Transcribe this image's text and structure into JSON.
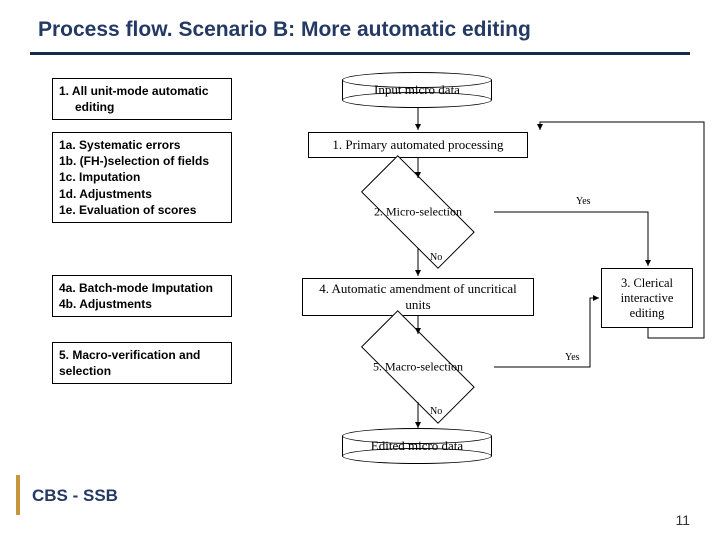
{
  "title": "Process flow. Scenario B: More automatic editing",
  "footer": {
    "label": "CBS - SSB",
    "page": "11"
  },
  "left": {
    "b1": {
      "title": "1. All unit-mode automatic",
      "sub": "editing"
    },
    "b1a": {
      "l1": "1a. Systematic errors",
      "l2": "1b. (FH-)selection of fields",
      "l3": "1c. Imputation",
      "l4": "1d. Adjustments",
      "l5": "1e. Evaluation of scores"
    },
    "b4": {
      "l1": "4a. Batch-mode Imputation",
      "l2": "4b. Adjustments"
    },
    "b5": {
      "l1": "5. Macro-verification and",
      "l2": "selection"
    }
  },
  "flow": {
    "input": "Input micro data",
    "step1": "1. Primary automated processing",
    "step2": "2. Micro-selection",
    "step3": "3. Clerical interactive editing",
    "step4": "4. Automatic amendment of uncritical units",
    "step5": "5. Macro-selection",
    "output": "Edited micro data",
    "yes": "Yes",
    "no": "No"
  }
}
